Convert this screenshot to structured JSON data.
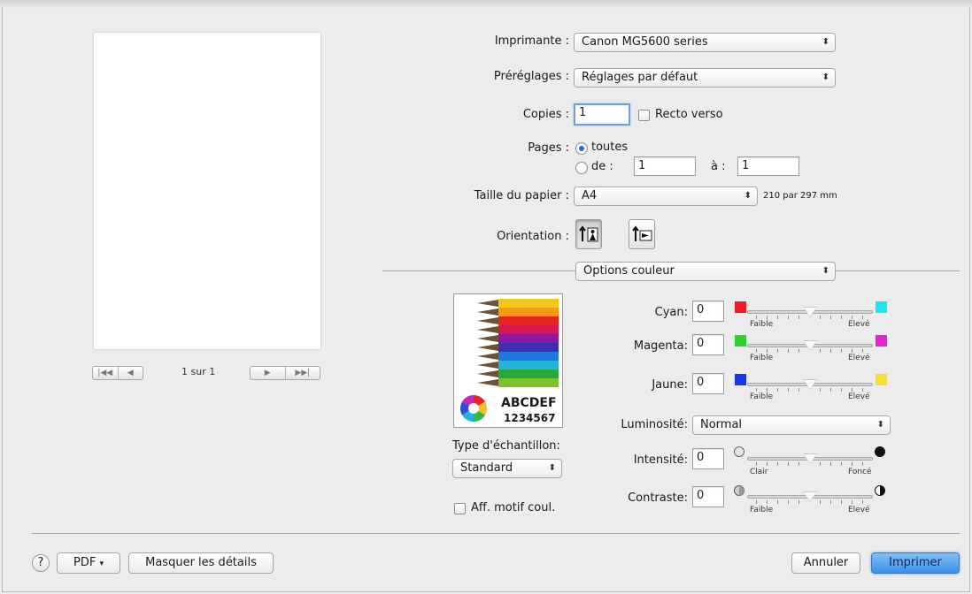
{
  "preview": {
    "page_indicator": "1 sur 1",
    "nav_left": [
      "|◀◀",
      "◀"
    ],
    "nav_right": [
      "▶",
      "▶▶|"
    ]
  },
  "printer": {
    "label": "Imprimante",
    "value": "Canon MG5600 series"
  },
  "presets": {
    "label": "Préréglages",
    "value": "Réglages par défaut"
  },
  "copies": {
    "label": "Copies",
    "value": "1",
    "duplex_label": "Recto verso",
    "duplex_checked": false
  },
  "pages": {
    "label": "Pages",
    "all_label": "toutes",
    "from_label": "de :",
    "from_value": "1",
    "to_label": "à :",
    "to_value": "1",
    "selected": "all"
  },
  "paper": {
    "label": "Taille du papier",
    "value": "A4",
    "dimensions": "210 par 297 mm"
  },
  "orientation": {
    "label": "Orientation",
    "selected": "portrait"
  },
  "section": {
    "value": "Options couleur"
  },
  "sample": {
    "text1": "ABCDEF",
    "text2": "1234567",
    "type_label": "Type d'échantillon:",
    "type_value": "Standard",
    "show_pattern_label": "Aff. motif coul.",
    "show_pattern_checked": false
  },
  "color": {
    "cyan": {
      "label": "Cyan:",
      "value": "0",
      "low_label": "Faible",
      "high_label": "Elevé",
      "low_color": "#ee1d25",
      "high_color": "#19e6ee"
    },
    "magenta": {
      "label": "Magenta:",
      "value": "0",
      "low_label": "Faible",
      "high_label": "Elevé",
      "low_color": "#2fd12a",
      "high_color": "#e922d6"
    },
    "yellow": {
      "label": "Jaune:",
      "value": "0",
      "low_label": "Faible",
      "high_label": "Elevé",
      "low_color": "#1a37e6",
      "high_color": "#f3e12b"
    },
    "brightness": {
      "label": "Luminosité:",
      "value": "Normal"
    },
    "intensity": {
      "label": "Intensité:",
      "value": "0",
      "low_label": "Clair",
      "high_label": "Foncé"
    },
    "contrast": {
      "label": "Contraste:",
      "value": "0",
      "low_label": "Faible",
      "high_label": "Elevé"
    }
  },
  "footer": {
    "help": "?",
    "pdf": "PDF",
    "hide_details": "Masquer les détails",
    "cancel": "Annuler",
    "print": "Imprimer"
  }
}
